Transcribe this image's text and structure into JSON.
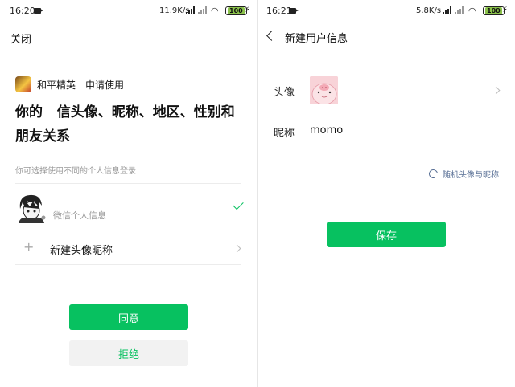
{
  "left": {
    "status": {
      "time": "16:20",
      "speed": "11.9K/s",
      "battery": "100"
    },
    "close_label": "关闭",
    "app_name": "和平精英",
    "apply_text": "申请使用",
    "headline_line1": "你的   信头像、昵称、地区、性别和",
    "headline_line2": "朋友关系",
    "hint": "你可选择使用不同的个人信息登录",
    "options": [
      {
        "label": "微信个人信息",
        "selected": true
      },
      {
        "label": "新建头像昵称",
        "selected": false
      }
    ],
    "agree_label": "同意",
    "reject_label": "拒绝"
  },
  "right": {
    "status": {
      "time": "16:21",
      "speed": "5.8K/s",
      "battery": "100"
    },
    "title": "新建用户信息",
    "avatar_label": "头像",
    "nickname_label": "昵称",
    "nickname_value": "momo",
    "random_label": "随机头像与昵称",
    "save_label": "保存"
  },
  "colors": {
    "accent": "#07c160",
    "link": "#586f95",
    "hint": "#9a9a9a"
  },
  "icons": [
    "camera-icon",
    "signal-icon",
    "wifi-icon",
    "battery-icon",
    "charging-icon",
    "check-icon",
    "plus-icon",
    "chevron-right-icon",
    "back-arrow-icon",
    "refresh-icon"
  ]
}
